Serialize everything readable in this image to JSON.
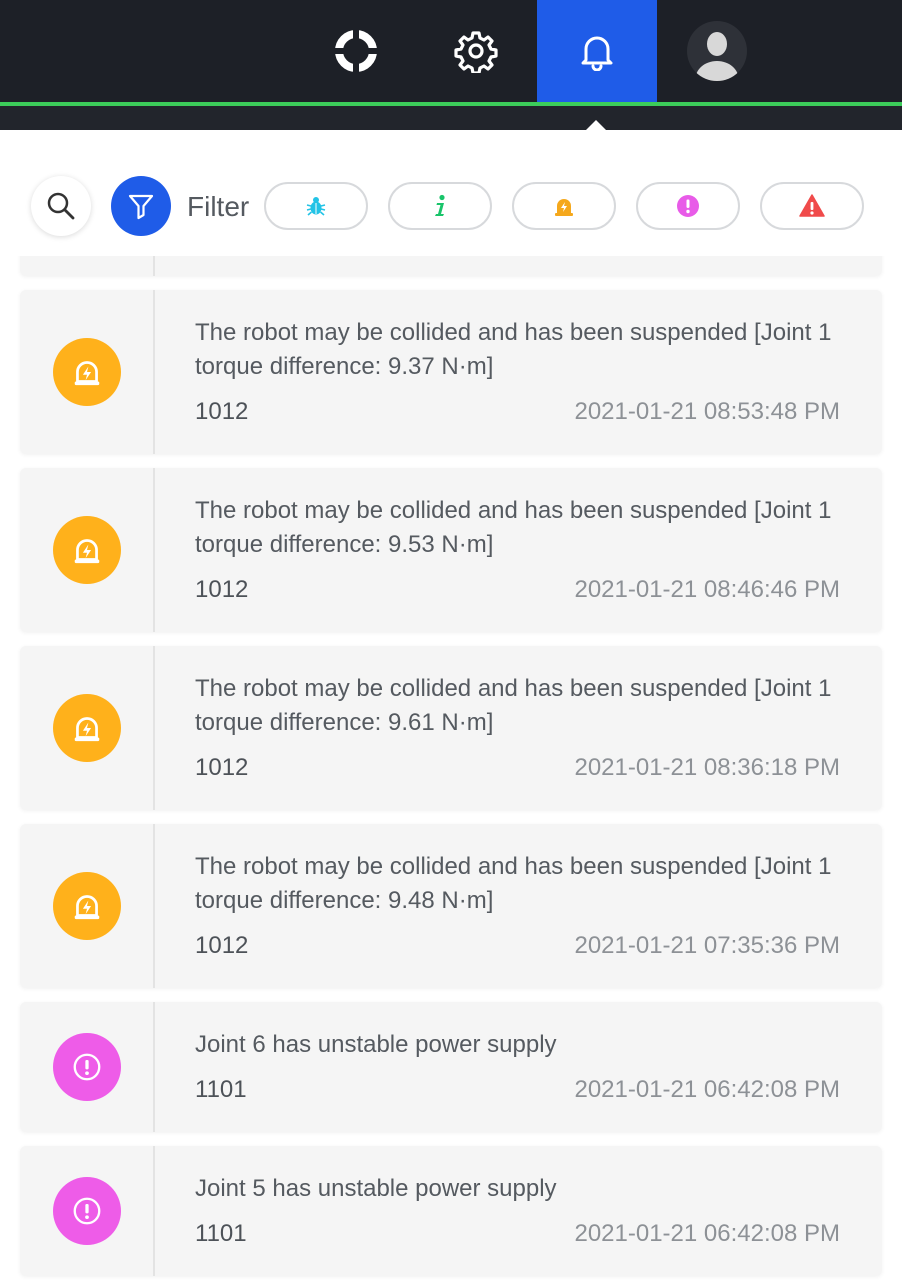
{
  "nav": {
    "items": [
      {
        "name": "help-icon",
        "active": false
      },
      {
        "name": "gear-icon",
        "active": false
      },
      {
        "name": "bell-icon",
        "active": true
      },
      {
        "name": "avatar",
        "active": false
      }
    ],
    "colors": {
      "bar": "#1d2027",
      "active": "#1f5ce8",
      "accent_line": "#3ccd5a"
    }
  },
  "filter": {
    "label": "Filter",
    "chips": [
      {
        "icon": "bug-icon",
        "color": "#22c3e6"
      },
      {
        "icon": "info-icon",
        "color": "#19c46a"
      },
      {
        "icon": "warning-light-icon",
        "color": "#f5a81c"
      },
      {
        "icon": "exclamation-circle-icon",
        "color": "#e85be8"
      },
      {
        "icon": "alert-triangle-icon",
        "color": "#f04b4b"
      }
    ]
  },
  "notifications": [
    {
      "type": "warning-light",
      "color": "#ffb11b",
      "message": "The robot may be collided and has been suspended [Joint 1 torque difference: 9.37 N·m]",
      "code": "1012",
      "time": "2021-01-21 08:53:48 PM"
    },
    {
      "type": "warning-light",
      "color": "#ffb11b",
      "message": "The robot may be collided and has been suspended [Joint 1 torque difference: 9.53 N·m]",
      "code": "1012",
      "time": "2021-01-21 08:46:46 PM"
    },
    {
      "type": "warning-light",
      "color": "#ffb11b",
      "message": "The robot may be collided and has been suspended [Joint 1 torque difference: 9.61 N·m]",
      "code": "1012",
      "time": "2021-01-21 08:36:18 PM"
    },
    {
      "type": "warning-light",
      "color": "#ffb11b",
      "message": "The robot may be collided and has been suspended [Joint 1 torque difference: 9.48 N·m]",
      "code": "1012",
      "time": "2021-01-21 07:35:36 PM"
    },
    {
      "type": "exclamation",
      "color": "#ee5ce8",
      "message": "Joint 6 has unstable power supply",
      "code": "1101",
      "time": "2021-01-21 06:42:08 PM"
    },
    {
      "type": "exclamation",
      "color": "#ee5ce8",
      "message": "Joint 5 has unstable power supply",
      "code": "1101",
      "time": "2021-01-21 06:42:08 PM"
    }
  ]
}
